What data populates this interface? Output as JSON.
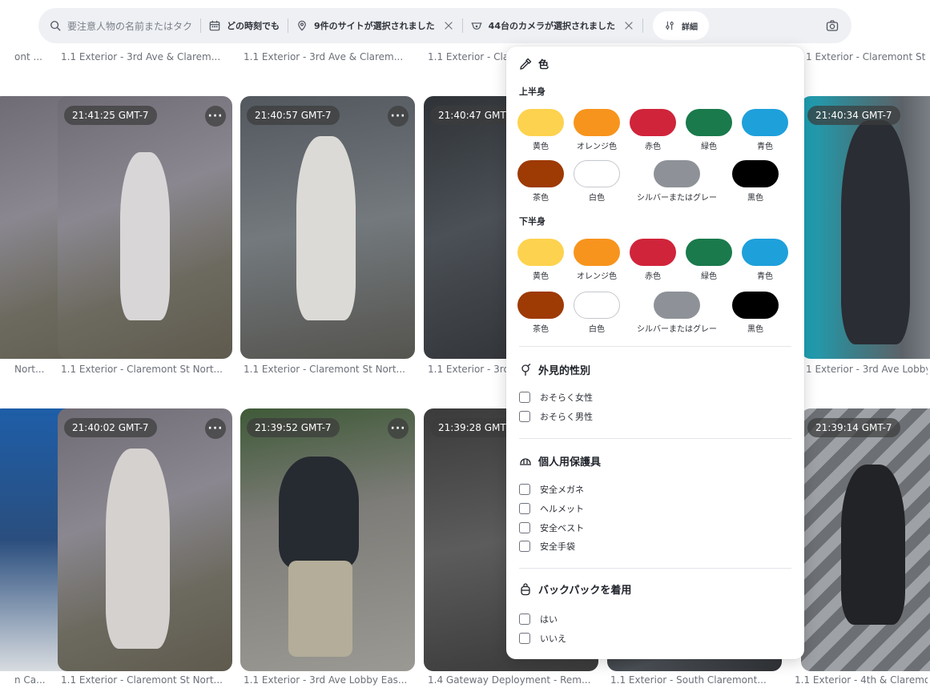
{
  "filter_bar": {
    "search_placeholder": "要注意人物の名前またはタク",
    "time_label": "どの時刻でも",
    "sites_label": "9件のサイトが選択されました",
    "cameras_label": "44台のカメラが選択されました",
    "detail_label": "詳細"
  },
  "top_captions": [
    "ont ...",
    "1.1 Exterior - 3rd Ave & Clarem...",
    "1.1 Exterior - 3rd Ave & Clarem...",
    "1.1 Exterior - Cla",
    "1 Exterior - Claremont St"
  ],
  "row1": {
    "tiles": [
      {
        "timestamp": "",
        "more": "···"
      },
      {
        "timestamp": "21:41:25 GMT-7",
        "more": "···"
      },
      {
        "timestamp": "21:40:57 GMT-7",
        "more": "···"
      },
      {
        "timestamp": "21:40:47 GMT",
        "more": ""
      },
      {
        "timestamp": "21:40:34 GMT-7",
        "more": ""
      }
    ],
    "captions": [
      "Nort...",
      "1.1 Exterior - Claremont St Nort...",
      "1.1 Exterior - Claremont St Nort...",
      "1.1 Exterior - 3rd",
      "1 Exterior - 3rd Ave Lobby"
    ]
  },
  "row2": {
    "tiles": [
      {
        "timestamp": "",
        "more": "···"
      },
      {
        "timestamp": "21:40:02 GMT-7",
        "more": "···"
      },
      {
        "timestamp": "21:39:52 GMT-7",
        "more": "···"
      },
      {
        "timestamp": "21:39:28 GMT",
        "more": ""
      },
      {
        "timestamp": "21:39:14 GMT-7",
        "more": ""
      }
    ],
    "captions": [
      "n Ca...",
      "1.1 Exterior - Claremont St Nort...",
      "1.1 Exterior - 3rd Ave Lobby Eas...",
      "1.4 Gateway Deployment - Rem...",
      "1.1 Exterior - South Claremont...",
      "1.1 Exterior - 4th & Claremo"
    ]
  },
  "panel": {
    "color_heading": "色",
    "upper_body_label": "上半身",
    "lower_body_label": "下半身",
    "colors": [
      {
        "name": "黄色",
        "hex": "#fdd24e"
      },
      {
        "name": "オレンジ色",
        "hex": "#f7941d"
      },
      {
        "name": "赤色",
        "hex": "#d0243a"
      },
      {
        "name": "緑色",
        "hex": "#1a7a4c"
      },
      {
        "name": "青色",
        "hex": "#1ea0db"
      },
      {
        "name": "茶色",
        "hex": "#9e3a04"
      },
      {
        "name": "白色",
        "hex": "#ffffff"
      },
      {
        "name": "シルバーまたはグレー",
        "hex": "#8e9298"
      },
      {
        "name": "黒色",
        "hex": "#000000"
      }
    ],
    "gender_heading": "外見的性別",
    "gender_options": [
      "おそらく女性",
      "おそらく男性"
    ],
    "ppe_heading": "個人用保護具",
    "ppe_options": [
      "安全メガネ",
      "ヘルメット",
      "安全ベスト",
      "安全手袋"
    ],
    "backpack_heading": "バックパックを着用",
    "backpack_options": [
      "はい",
      "いいえ"
    ]
  }
}
